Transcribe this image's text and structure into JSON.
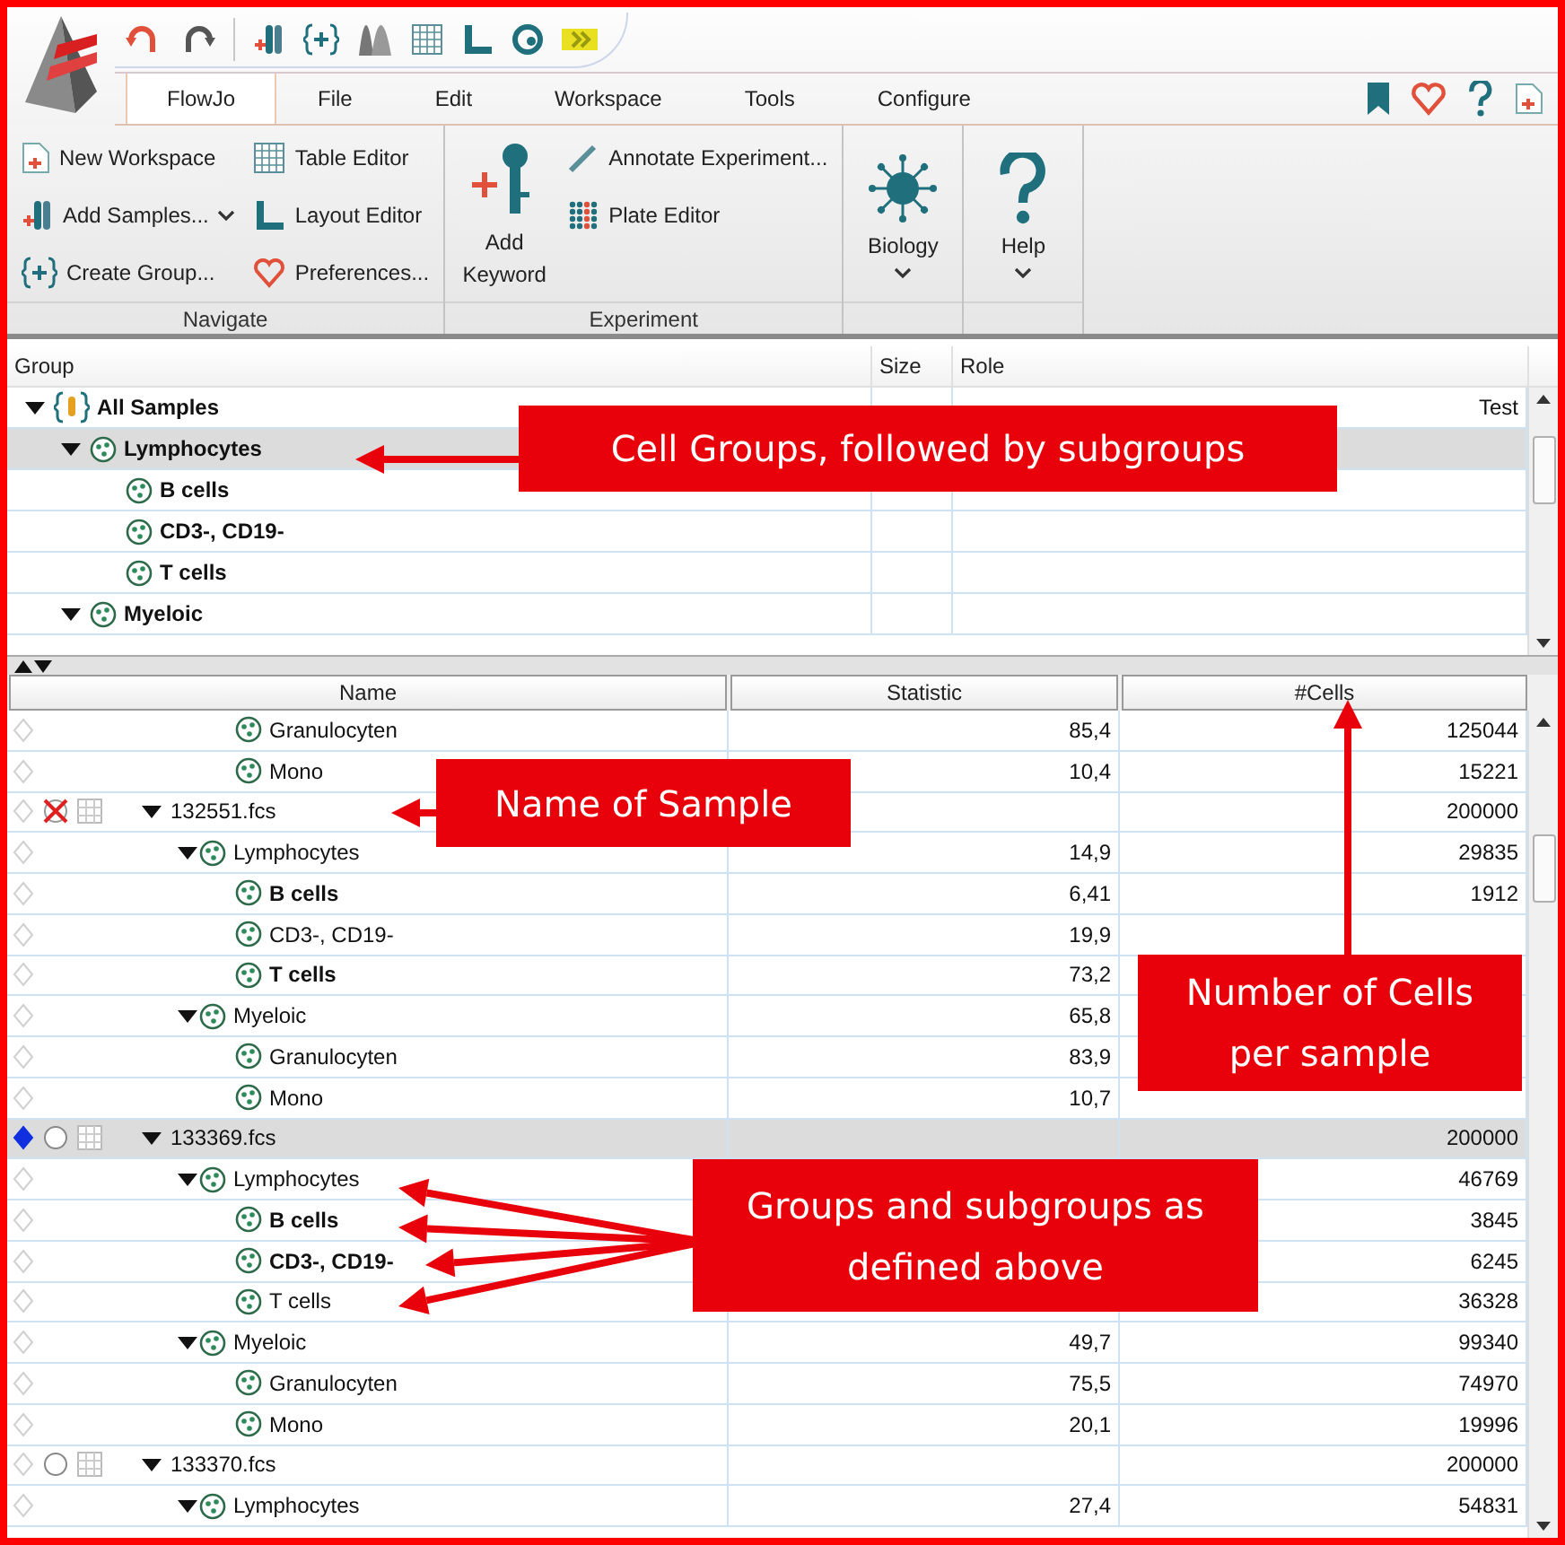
{
  "menu_tabs": [
    {
      "label": "FlowJo",
      "selected": true
    },
    {
      "label": "File",
      "selected": false
    },
    {
      "label": "Edit",
      "selected": false
    },
    {
      "label": "Workspace",
      "selected": false
    },
    {
      "label": "Tools",
      "selected": false
    },
    {
      "label": "Configure",
      "selected": false
    }
  ],
  "ribbon_groups": [
    {
      "label": "Navigate",
      "items": [
        {
          "kind": "small",
          "label": "New Workspace"
        },
        {
          "kind": "small",
          "label": "Add Samples...",
          "dropdown": true
        },
        {
          "kind": "small",
          "label": "Create Group..."
        },
        {
          "kind": "small",
          "label": "Table Editor"
        },
        {
          "kind": "small",
          "label": "Layout Editor"
        },
        {
          "kind": "small",
          "label": "Preferences..."
        }
      ]
    },
    {
      "label": "Experiment",
      "items": [
        {
          "kind": "large",
          "label": "Add Keyword"
        },
        {
          "kind": "small",
          "label": "Annotate Experiment..."
        },
        {
          "kind": "small",
          "label": "Plate Editor"
        }
      ]
    },
    {
      "items": [
        {
          "kind": "large",
          "label": "Biology",
          "dropdown": true
        }
      ]
    },
    {
      "items": [
        {
          "kind": "large",
          "label": "Help",
          "dropdown": true
        }
      ]
    }
  ],
  "groups_table": {
    "columns": [
      "Group",
      "Size",
      "Role"
    ],
    "rows": [
      {
        "kind": "all",
        "name": "All Samples",
        "role": "Test",
        "expanded": true,
        "selected": false,
        "children": [
          {
            "kind": "group",
            "name": "Lymphocytes",
            "expanded": true,
            "selected": true,
            "children": [
              {
                "kind": "group",
                "name": "B cells",
                "selected": false
              },
              {
                "kind": "group",
                "name": "CD3-, CD19-",
                "selected": false
              },
              {
                "kind": "group",
                "name": "T cells",
                "selected": false
              }
            ]
          },
          {
            "kind": "group",
            "name": "Myeloic",
            "expanded": true,
            "selected": false
          }
        ]
      }
    ]
  },
  "samples_table": {
    "columns": [
      "Name",
      "Statistic",
      "#Cells"
    ],
    "rows": [
      {
        "kind": "continued",
        "children": [
          {
            "kind": "continued",
            "children": [
              {
                "kind": "gate",
                "name": "Granulocyten",
                "statistic": "85,4",
                "cells": "125044",
                "bold": false
              },
              {
                "kind": "gate",
                "name": "Mono",
                "statistic": "10,4",
                "cells": "15221",
                "bold": false
              }
            ]
          }
        ]
      },
      {
        "kind": "sample",
        "name": "132551.fcs",
        "cells": "200000",
        "selected": false,
        "excluded": true,
        "expanded": true,
        "children": [
          {
            "kind": "gate",
            "name": "Lymphocytes",
            "statistic": "14,9",
            "cells": "29835",
            "bold": false,
            "expanded": true,
            "children": [
              {
                "kind": "gate",
                "name": "B cells",
                "statistic": "6,41",
                "cells": "1912",
                "bold": true
              },
              {
                "kind": "gate",
                "name": "CD3-, CD19-",
                "statistic": "19,9",
                "bold": false
              },
              {
                "kind": "gate",
                "name": "T cells",
                "statistic": "73,2",
                "bold": true
              }
            ]
          },
          {
            "kind": "gate",
            "name": "Myeloic",
            "statistic": "65,8",
            "bold": false,
            "expanded": true,
            "children": [
              {
                "kind": "gate",
                "name": "Granulocyten",
                "statistic": "83,9",
                "bold": false
              },
              {
                "kind": "gate",
                "name": "Mono",
                "statistic": "10,7",
                "bold": false
              }
            ]
          }
        ]
      },
      {
        "kind": "sample",
        "name": "133369.fcs",
        "cells": "200000",
        "selected": true,
        "excluded": false,
        "expanded": true,
        "children": [
          {
            "kind": "gate",
            "name": "Lymphocytes",
            "cells": "46769",
            "bold": false,
            "expanded": true,
            "children": [
              {
                "kind": "gate",
                "name": "B cells",
                "cells": "3845",
                "bold": true
              },
              {
                "kind": "gate",
                "name": "CD3-, CD19-",
                "cells": "6245",
                "bold": true
              },
              {
                "kind": "gate",
                "name": "T cells",
                "cells": "36328",
                "bold": false
              }
            ]
          },
          {
            "kind": "gate",
            "name": "Myeloic",
            "statistic": "49,7",
            "cells": "99340",
            "bold": false,
            "expanded": true,
            "children": [
              {
                "kind": "gate",
                "name": "Granulocyten",
                "statistic": "75,5",
                "cells": "74970",
                "bold": false
              },
              {
                "kind": "gate",
                "name": "Mono",
                "statistic": "20,1",
                "cells": "19996",
                "bold": false
              }
            ]
          }
        ]
      },
      {
        "kind": "sample",
        "name": "133370.fcs",
        "cells": "200000",
        "selected": false,
        "excluded": false,
        "expanded": true,
        "children": [
          {
            "kind": "gate",
            "name": "Lymphocytes",
            "statistic": "27,4",
            "cells": "54831",
            "bold": false,
            "expanded": true
          }
        ]
      }
    ]
  },
  "annotations": [
    {
      "text": "Cell Groups, followed by subgroups"
    },
    {
      "text": "Name of Sample"
    },
    {
      "text": "Number of Cells per sample"
    },
    {
      "text": "Groups and subgroups as defined above"
    }
  ]
}
